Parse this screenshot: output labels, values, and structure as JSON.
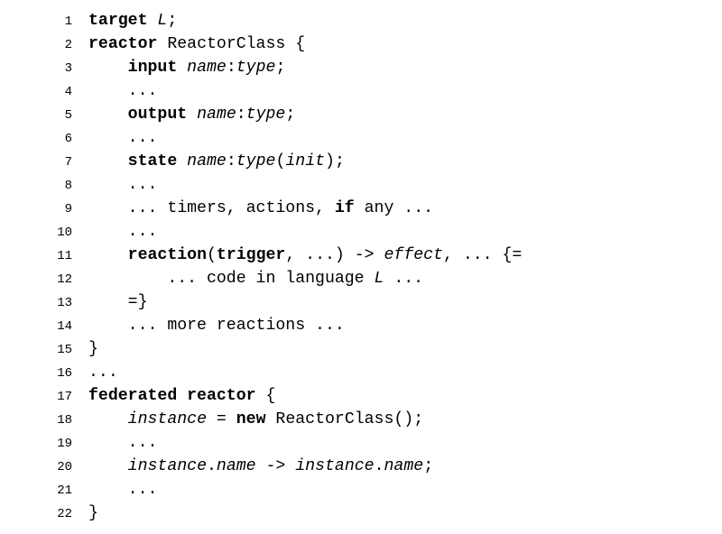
{
  "lines": [
    {
      "num": "1",
      "segments": [
        {
          "t": "target ",
          "b": true
        },
        {
          "t": "L",
          "i": true
        },
        {
          "t": ";"
        }
      ]
    },
    {
      "num": "2",
      "segments": [
        {
          "t": "reactor ",
          "b": true
        },
        {
          "t": "ReactorClass {"
        }
      ]
    },
    {
      "num": "3",
      "segments": [
        {
          "t": "    "
        },
        {
          "t": "input ",
          "b": true
        },
        {
          "t": "name",
          "i": true
        },
        {
          "t": ":"
        },
        {
          "t": "type",
          "i": true
        },
        {
          "t": ";"
        }
      ]
    },
    {
      "num": "4",
      "segments": [
        {
          "t": "    ..."
        }
      ]
    },
    {
      "num": "5",
      "segments": [
        {
          "t": "    "
        },
        {
          "t": "output ",
          "b": true
        },
        {
          "t": "name",
          "i": true
        },
        {
          "t": ":"
        },
        {
          "t": "type",
          "i": true
        },
        {
          "t": ";"
        }
      ]
    },
    {
      "num": "6",
      "segments": [
        {
          "t": "    ..."
        }
      ]
    },
    {
      "num": "7",
      "segments": [
        {
          "t": "    "
        },
        {
          "t": "state ",
          "b": true
        },
        {
          "t": "name",
          "i": true
        },
        {
          "t": ":"
        },
        {
          "t": "type",
          "i": true
        },
        {
          "t": "("
        },
        {
          "t": "init",
          "i": true
        },
        {
          "t": ");"
        }
      ]
    },
    {
      "num": "8",
      "segments": [
        {
          "t": "    ..."
        }
      ]
    },
    {
      "num": "9",
      "segments": [
        {
          "t": "    ... timers, actions, "
        },
        {
          "t": "if",
          "b": true
        },
        {
          "t": " any ..."
        }
      ]
    },
    {
      "num": "10",
      "segments": [
        {
          "t": "    ..."
        }
      ]
    },
    {
      "num": "11",
      "segments": [
        {
          "t": "    "
        },
        {
          "t": "reaction",
          "b": true
        },
        {
          "t": "("
        },
        {
          "t": "trigger",
          "b": true
        },
        {
          "t": ", ...) -> "
        },
        {
          "t": "effect",
          "i": true
        },
        {
          "t": ", ... {="
        }
      ]
    },
    {
      "num": "12",
      "segments": [
        {
          "t": "        ... code in language "
        },
        {
          "t": "L",
          "i": true
        },
        {
          "t": " ..."
        }
      ]
    },
    {
      "num": "13",
      "segments": [
        {
          "t": "    =}"
        }
      ]
    },
    {
      "num": "14",
      "segments": [
        {
          "t": "    ... more reactions ..."
        }
      ]
    },
    {
      "num": "15",
      "segments": [
        {
          "t": "}"
        }
      ]
    },
    {
      "num": "16",
      "segments": [
        {
          "t": "..."
        }
      ]
    },
    {
      "num": "17",
      "segments": [
        {
          "t": "federated reactor ",
          "b": true
        },
        {
          "t": "{"
        }
      ]
    },
    {
      "num": "18",
      "segments": [
        {
          "t": "    "
        },
        {
          "t": "instance",
          "i": true
        },
        {
          "t": " = "
        },
        {
          "t": "new",
          "b": true
        },
        {
          "t": " ReactorClass();"
        }
      ]
    },
    {
      "num": "19",
      "segments": [
        {
          "t": "    ..."
        }
      ]
    },
    {
      "num": "20",
      "segments": [
        {
          "t": "    "
        },
        {
          "t": "instance",
          "i": true
        },
        {
          "t": "."
        },
        {
          "t": "name",
          "i": true
        },
        {
          "t": " -> "
        },
        {
          "t": "instance",
          "i": true
        },
        {
          "t": "."
        },
        {
          "t": "name",
          "i": true
        },
        {
          "t": ";"
        }
      ]
    },
    {
      "num": "21",
      "segments": [
        {
          "t": "    ..."
        }
      ]
    },
    {
      "num": "22",
      "segments": [
        {
          "t": "}"
        }
      ]
    }
  ]
}
